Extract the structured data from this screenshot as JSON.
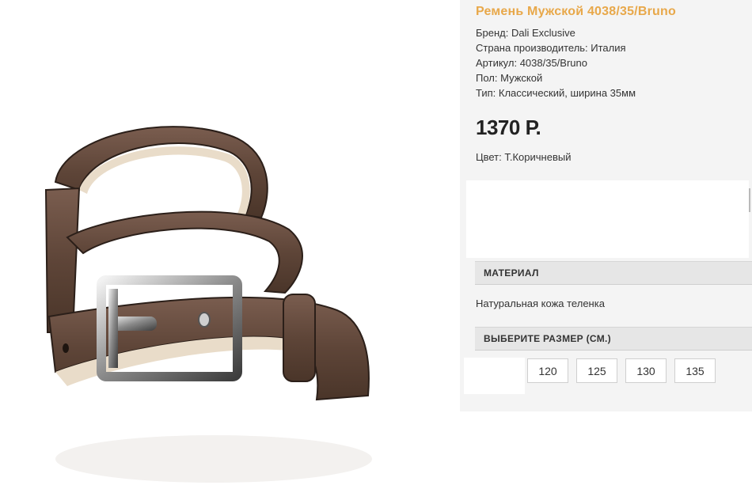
{
  "product": {
    "title": "Ремень Мужской 4038/35/Bruno",
    "props": [
      "Бренд: Dali Exclusive",
      "Страна производитель: Италия",
      "Артикул: 4038/35/Bruno",
      "Пол: Мужской",
      "Тип: Классический, ширина 35мм"
    ],
    "price": "1370 Р.",
    "color": "Цвет: Т.Коричневый"
  },
  "material": {
    "heading": "МАТЕРИАЛ",
    "value": "Натуральная кожа теленка"
  },
  "size": {
    "heading": "ВЫБЕРИТЕ РАЗМЕР (СМ.)",
    "options": [
      "120",
      "125",
      "130",
      "135"
    ]
  },
  "colors": {
    "title": "#e8a84a",
    "leather": "#5e4538",
    "panel": "#f4f4f4"
  }
}
